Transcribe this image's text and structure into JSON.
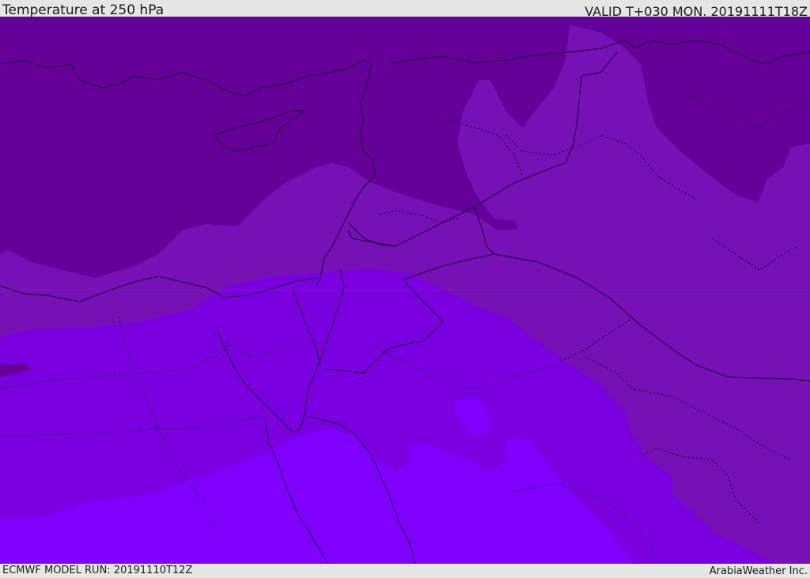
{
  "header": {
    "title": "Temperature at 250 hPa",
    "valid": "VALID T+030 MON. 20191111T18Z"
  },
  "footer": {
    "model_run": "ECMWF MODEL RUN: 20191110T12Z",
    "credit": "ArabiaWeather Inc."
  },
  "map": {
    "region": "Eastern Mediterranean and Middle East",
    "field": "250 hPa temperature shading",
    "colors": {
      "coldest_band": "#650099",
      "cold_band": "#7511b5",
      "mid_band": "#7a00e0",
      "warm_band": "#7f00ff",
      "coastline": "#1a0033"
    }
  }
}
